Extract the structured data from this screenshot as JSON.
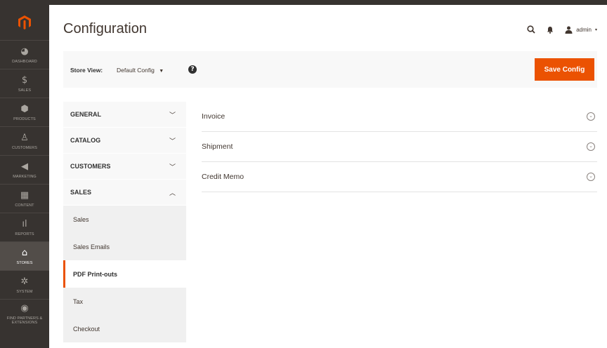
{
  "app": {
    "logo_icon": "magento-logo-icon",
    "accent": "#eb5202",
    "sidebar_bg": "#373330"
  },
  "sidebar": {
    "items": [
      {
        "label": "DASHBOARD",
        "icon": "dashboard-icon",
        "glyph": "◕"
      },
      {
        "label": "SALES",
        "icon": "dollar-icon",
        "glyph": "$"
      },
      {
        "label": "PRODUCTS",
        "icon": "cube-icon",
        "glyph": "⬢"
      },
      {
        "label": "CUSTOMERS",
        "icon": "person-icon",
        "glyph": "♙"
      },
      {
        "label": "MARKETING",
        "icon": "megaphone-icon",
        "glyph": "◀"
      },
      {
        "label": "CONTENT",
        "icon": "content-icon",
        "glyph": "▦"
      },
      {
        "label": "REPORTS",
        "icon": "bar-chart-icon",
        "glyph": "ıl"
      },
      {
        "label": "STORES",
        "icon": "store-icon",
        "glyph": "⌂"
      },
      {
        "label": "SYSTEM",
        "icon": "gear-icon",
        "glyph": "✲"
      },
      {
        "label": "FIND PARTNERS & EXTENSIONS",
        "icon": "partners-icon",
        "glyph": "◉"
      }
    ],
    "active_index": 7
  },
  "header": {
    "title": "Configuration",
    "user": "admin",
    "search_icon": "search-icon",
    "bell_icon": "bell-icon"
  },
  "storebar": {
    "label": "Store View:",
    "value": "Default Config",
    "save_label": "Save Config"
  },
  "tabs": {
    "general": "GENERAL",
    "catalog": "CATALOG",
    "customers": "CUSTOMERS",
    "sales": "SALES",
    "sales_items": [
      "Sales",
      "Sales Emails",
      "PDF Print-outs",
      "Tax",
      "Checkout"
    ],
    "active_sub": "PDF Print-outs"
  },
  "sections": [
    "Invoice",
    "Shipment",
    "Credit Memo"
  ]
}
